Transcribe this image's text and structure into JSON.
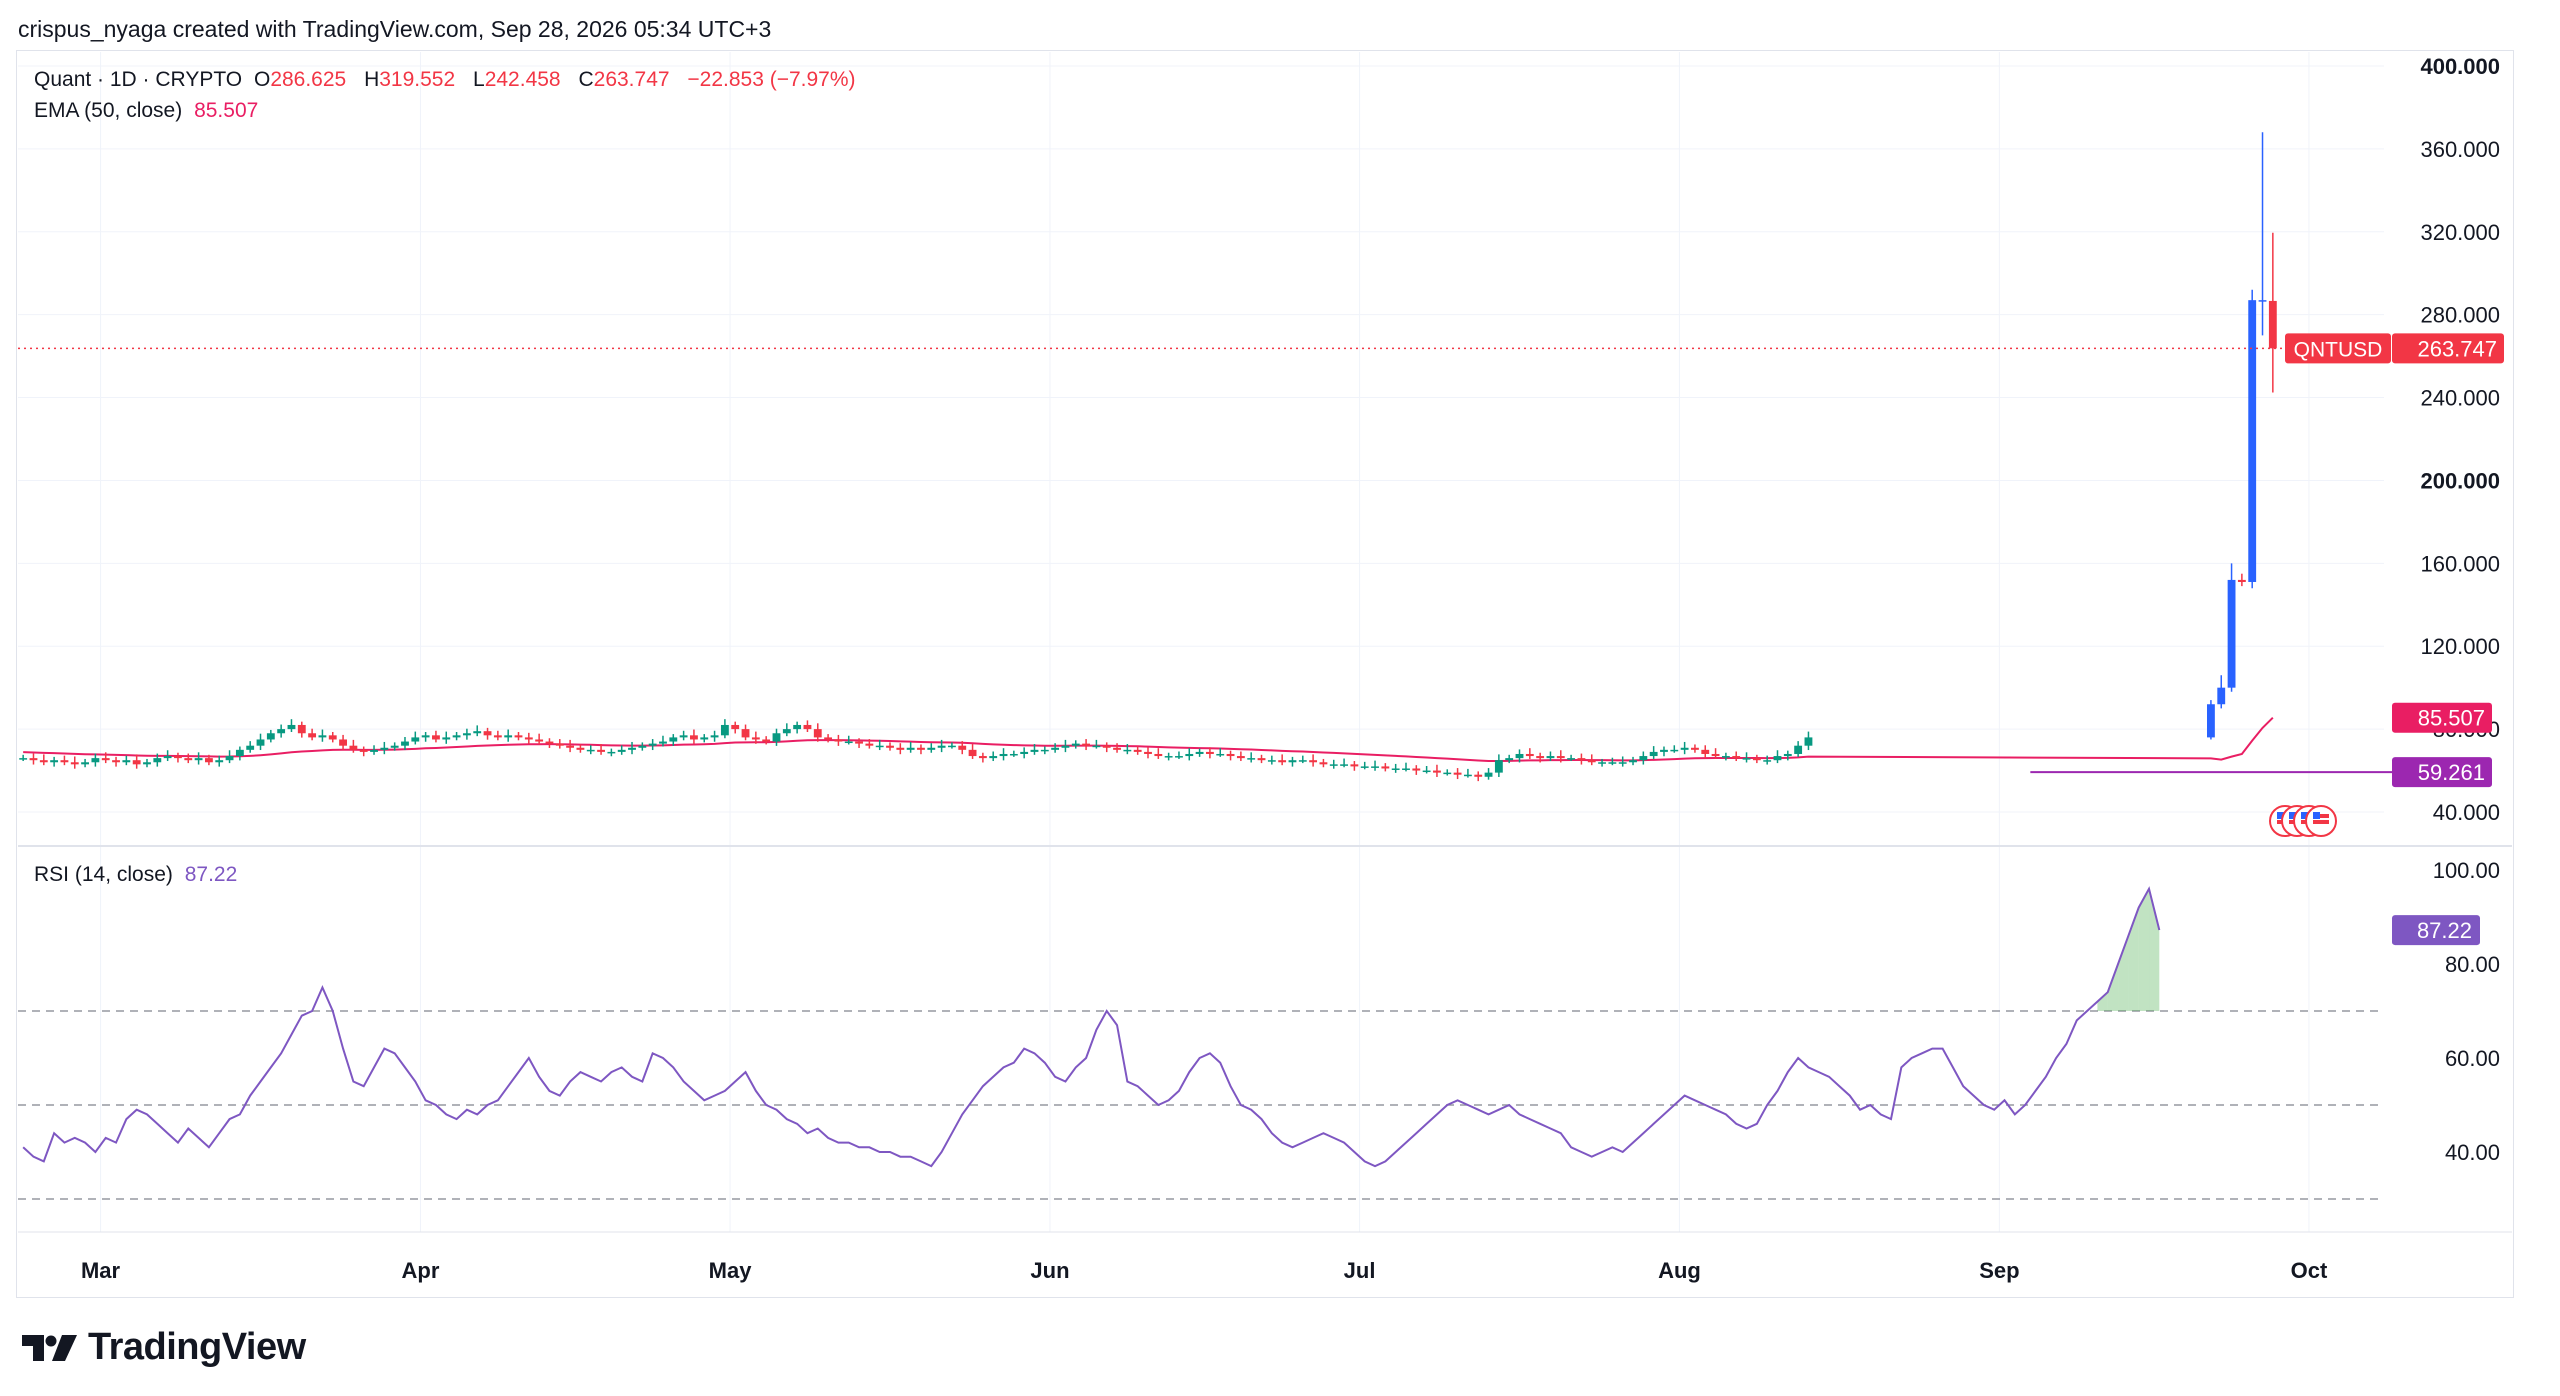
{
  "header": {
    "credit": "crispus_nyaga created with TradingView.com, Sep 28, 2026 05:34 UTC+3"
  },
  "legend": {
    "symbol": "Quant · 1D · CRYPTO",
    "o_label": "O",
    "o_value": "286.625",
    "h_label": "H",
    "h_value": "319.552",
    "l_label": "L",
    "l_value": "242.458",
    "c_label": "C",
    "c_value": "263.747",
    "change": "−22.853 (−7.97%)",
    "ema_label": "EMA (50, close)",
    "ema_value": "85.507",
    "rsi_label": "RSI (14, close)",
    "rsi_value": "87.22"
  },
  "brand": {
    "name": "TradingView"
  },
  "colors": {
    "up": "#2962ff",
    "down": "#f23645",
    "up_small": "#089981",
    "ema": "#e91e63",
    "rsi": "#7e57c2",
    "grid": "#f0f3fa",
    "axis_text": "#131722",
    "support": "#9c27b0"
  },
  "chart_data": [
    {
      "type": "candlestick",
      "title": "Quant · 1D · CRYPTO",
      "yaxis_ticks": [
        "40.000",
        "80.000",
        "120.000",
        "160.000",
        "200.000",
        "240.000",
        "280.000",
        "320.000",
        "360.000",
        "400.000"
      ],
      "ylim": [
        30,
        400
      ],
      "x_ticks": [
        "Mar",
        "Apr",
        "May",
        "Jun",
        "Jul",
        "Aug",
        "Sep",
        "Oct"
      ],
      "x_tick_dates": [
        "2026-03-01",
        "2026-04-01",
        "2026-05-01",
        "2026-06-01",
        "2026-07-01",
        "2026-08-01",
        "2026-09-01",
        "2026-10-01"
      ],
      "date_range": [
        "2026-02-21",
        "2026-09-28"
      ],
      "base_closes": [
        66,
        65,
        64,
        65,
        64,
        63,
        64,
        66,
        65,
        64,
        65,
        63,
        64,
        66,
        67,
        66,
        65,
        66,
        64,
        65,
        67,
        70,
        72,
        75,
        78,
        80,
        82,
        78,
        76,
        77,
        75,
        72,
        70,
        69,
        70,
        71,
        72,
        74,
        76,
        77,
        75,
        76,
        77,
        78,
        79,
        77,
        76,
        77,
        76,
        75,
        74,
        73,
        72,
        71,
        70,
        70,
        69,
        69,
        70,
        71,
        72,
        73,
        74,
        76,
        77,
        75,
        76,
        77,
        82,
        80,
        76,
        75,
        74,
        78,
        80,
        82,
        80,
        76,
        75,
        74,
        74,
        73,
        72,
        72,
        71,
        70,
        71,
        70,
        71,
        72,
        72,
        70,
        67,
        66,
        67,
        68,
        68,
        69,
        70,
        70,
        71,
        72,
        73,
        72,
        72,
        71,
        70,
        70,
        69,
        68,
        67,
        67,
        67,
        68,
        69,
        68,
        68,
        67,
        66,
        66,
        65,
        65,
        64,
        65,
        65,
        64,
        63,
        63,
        63,
        62,
        62,
        62,
        61,
        61,
        61,
        60,
        60,
        59,
        59,
        58,
        58,
        57,
        59,
        65,
        66,
        68,
        67,
        66,
        67,
        66,
        66,
        65,
        64,
        64,
        64,
        64,
        65,
        67,
        69,
        70,
        70,
        71,
        70,
        68,
        67,
        67,
        66,
        66,
        65,
        65,
        67,
        68,
        72,
        76
      ],
      "final_candles": [
        {
          "date": "2026-09-21",
          "open": 76,
          "high": 94,
          "low": 75,
          "close": 92
        },
        {
          "date": "2026-09-22",
          "open": 92,
          "high": 106,
          "low": 90,
          "close": 100
        },
        {
          "date": "2026-09-23",
          "open": 100,
          "high": 160,
          "low": 98,
          "close": 152
        },
        {
          "date": "2026-09-24",
          "open": 152,
          "high": 155,
          "low": 149,
          "close": 151
        },
        {
          "date": "2026-09-25",
          "open": 151,
          "high": 292,
          "low": 148,
          "close": 287
        },
        {
          "date": "2026-09-26",
          "open": 287,
          "high": 368,
          "low": 270,
          "close": 287
        },
        {
          "date": "2026-09-27",
          "open": 286.625,
          "high": 319.552,
          "low": 242.458,
          "close": 263.747
        }
      ],
      "ema": {
        "name": "EMA (50, close)",
        "last": 85.507
      },
      "price_label": {
        "symbol": "QNTUSD",
        "value": "263.747"
      },
      "ema_label_value": "85.507",
      "support": {
        "value": 59.261,
        "label": "59.261",
        "start_date": "2026-09-04"
      }
    },
    {
      "type": "line",
      "title": "RSI (14, close)",
      "ylim": [
        25,
        103
      ],
      "yaxis_ticks": [
        "40.00",
        "60.00",
        "80.00",
        "100.00"
      ],
      "bands": [
        30,
        50,
        70
      ],
      "values": [
        41,
        39,
        38,
        44,
        42,
        43,
        42,
        40,
        43,
        42,
        47,
        49,
        48,
        46,
        44,
        42,
        45,
        43,
        41,
        44,
        47,
        48,
        52,
        55,
        58,
        61,
        65,
        69,
        70,
        75,
        70,
        62,
        55,
        54,
        58,
        62,
        61,
        58,
        55,
        51,
        50,
        48,
        47,
        49,
        48,
        50,
        51,
        54,
        57,
        60,
        56,
        53,
        52,
        55,
        57,
        56,
        55,
        57,
        58,
        56,
        55,
        61,
        60,
        58,
        55,
        53,
        51,
        52,
        53,
        55,
        57,
        53,
        50,
        49,
        47,
        46,
        44,
        45,
        43,
        42,
        42,
        41,
        41,
        40,
        40,
        39,
        39,
        38,
        37,
        40,
        44,
        48,
        51,
        54,
        56,
        58,
        59,
        62,
        61,
        59,
        56,
        55,
        58,
        60,
        66,
        70,
        67,
        55,
        54,
        52,
        50,
        51,
        53,
        57,
        60,
        61,
        59,
        54,
        50,
        49,
        47,
        44,
        42,
        41,
        42,
        43,
        44,
        43,
        42,
        40,
        38,
        37,
        38,
        40,
        42,
        44,
        46,
        48,
        50,
        51,
        50,
        49,
        48,
        49,
        50,
        48,
        47,
        46,
        45,
        44,
        41,
        40,
        39,
        40,
        41,
        40,
        42,
        44,
        46,
        48,
        50,
        52,
        51,
        50,
        49,
        48,
        46,
        45,
        46,
        50,
        53,
        57,
        60,
        58,
        57,
        56,
        54,
        52,
        49,
        50,
        48,
        47,
        58,
        60,
        61,
        62,
        62,
        58,
        54,
        52,
        50,
        49,
        51,
        48,
        50,
        53,
        56,
        60,
        63,
        68,
        70,
        72,
        74,
        80,
        86,
        92,
        96,
        87.22
      ]
    }
  ]
}
